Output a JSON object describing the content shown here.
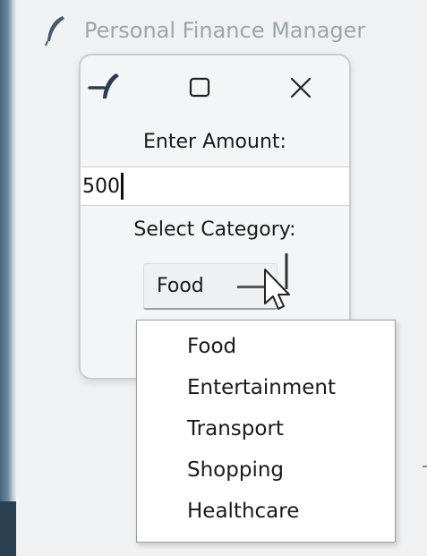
{
  "background_window": {
    "title": "Personal Finance Manager",
    "icon": "feather-icon"
  },
  "dialog": {
    "icon": "feather-icon",
    "maximize_icon": "maximize-icon",
    "close_icon": "close-icon",
    "amount_label": "Enter Amount:",
    "amount_value": "500",
    "category_label": "Select Category:",
    "category_selected": "Food"
  },
  "dropdown": {
    "items": [
      {
        "label": "Food"
      },
      {
        "label": "Entertainment"
      },
      {
        "label": "Transport"
      },
      {
        "label": "Shopping"
      },
      {
        "label": "Healthcare"
      }
    ]
  },
  "colors": {
    "window_bg": "#eff1f2",
    "title_text": "#9ea4a8",
    "text": "#1a1a1a",
    "input_bg": "#ffffff",
    "dropdown_border": "#9a9ea2"
  }
}
